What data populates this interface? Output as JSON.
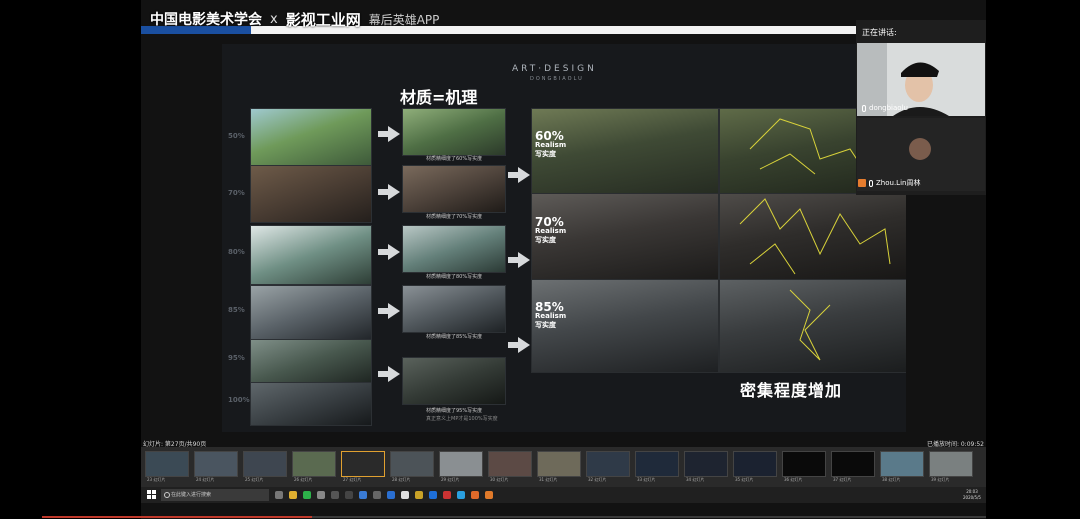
{
  "banner": {
    "org": "中国电影美术学会",
    "x": "x",
    "brand": "影视工业网",
    "app": "幕后英雄APP"
  },
  "slide": {
    "header": "ART·DESIGN",
    "subheader": "DONGBIAOLU",
    "title": "材质=机理",
    "left_percents": [
      "50%",
      "70%",
      "80%",
      "85%",
      "95%",
      "100%"
    ],
    "captions": [
      "材质精细度了60%写实度",
      "材质精细度了70%写实度",
      "材质精细度了80%写实度",
      "材质精细度了85%写实度",
      "材质精细度了95%写实度"
    ],
    "caption_extra": "真正意义上MP才是100%写实度",
    "realism": [
      {
        "percent": "60%",
        "word": "Realism",
        "cn": "写实度"
      },
      {
        "percent": "70%",
        "word": "Realism",
        "cn": "写实度"
      },
      {
        "percent": "85%",
        "word": "Realism",
        "cn": "写实度"
      }
    ],
    "density_label": "密集程度增加",
    "colors": {
      "accent_line": "#d8d23a",
      "bg": "#17191c"
    }
  },
  "participants": {
    "speaking_label": "正在讲话:",
    "users": [
      {
        "name": "dongbiaolu",
        "mic_icon": "mic-icon"
      },
      {
        "name": "Zhou.Lin周林",
        "mic_icon": "mic-icon"
      }
    ]
  },
  "strip": {
    "page_info": "幻灯片: 第27页/共90页",
    "elapsed": "已播放时间: 0:09:52",
    "thumbs": [
      {
        "label": "23 幻灯片"
      },
      {
        "label": "24 幻灯片"
      },
      {
        "label": "25 幻灯片"
      },
      {
        "label": "26 幻灯片"
      },
      {
        "label": "27 幻灯片"
      },
      {
        "label": "28 幻灯片"
      },
      {
        "label": "29 幻灯片"
      },
      {
        "label": "30 幻灯片"
      },
      {
        "label": "31 幻灯片"
      },
      {
        "label": "32 幻灯片"
      },
      {
        "label": "33 幻灯片"
      },
      {
        "label": "34 幻灯片"
      },
      {
        "label": "35 幻灯片"
      },
      {
        "label": "36 幻灯片"
      },
      {
        "label": "37 幻灯片"
      },
      {
        "label": "38 幻灯片"
      },
      {
        "label": "39 幻灯片"
      }
    ]
  },
  "taskbar": {
    "search_placeholder": "在此键入进行搜索",
    "time": "20:03",
    "date": "2020/5/5"
  }
}
